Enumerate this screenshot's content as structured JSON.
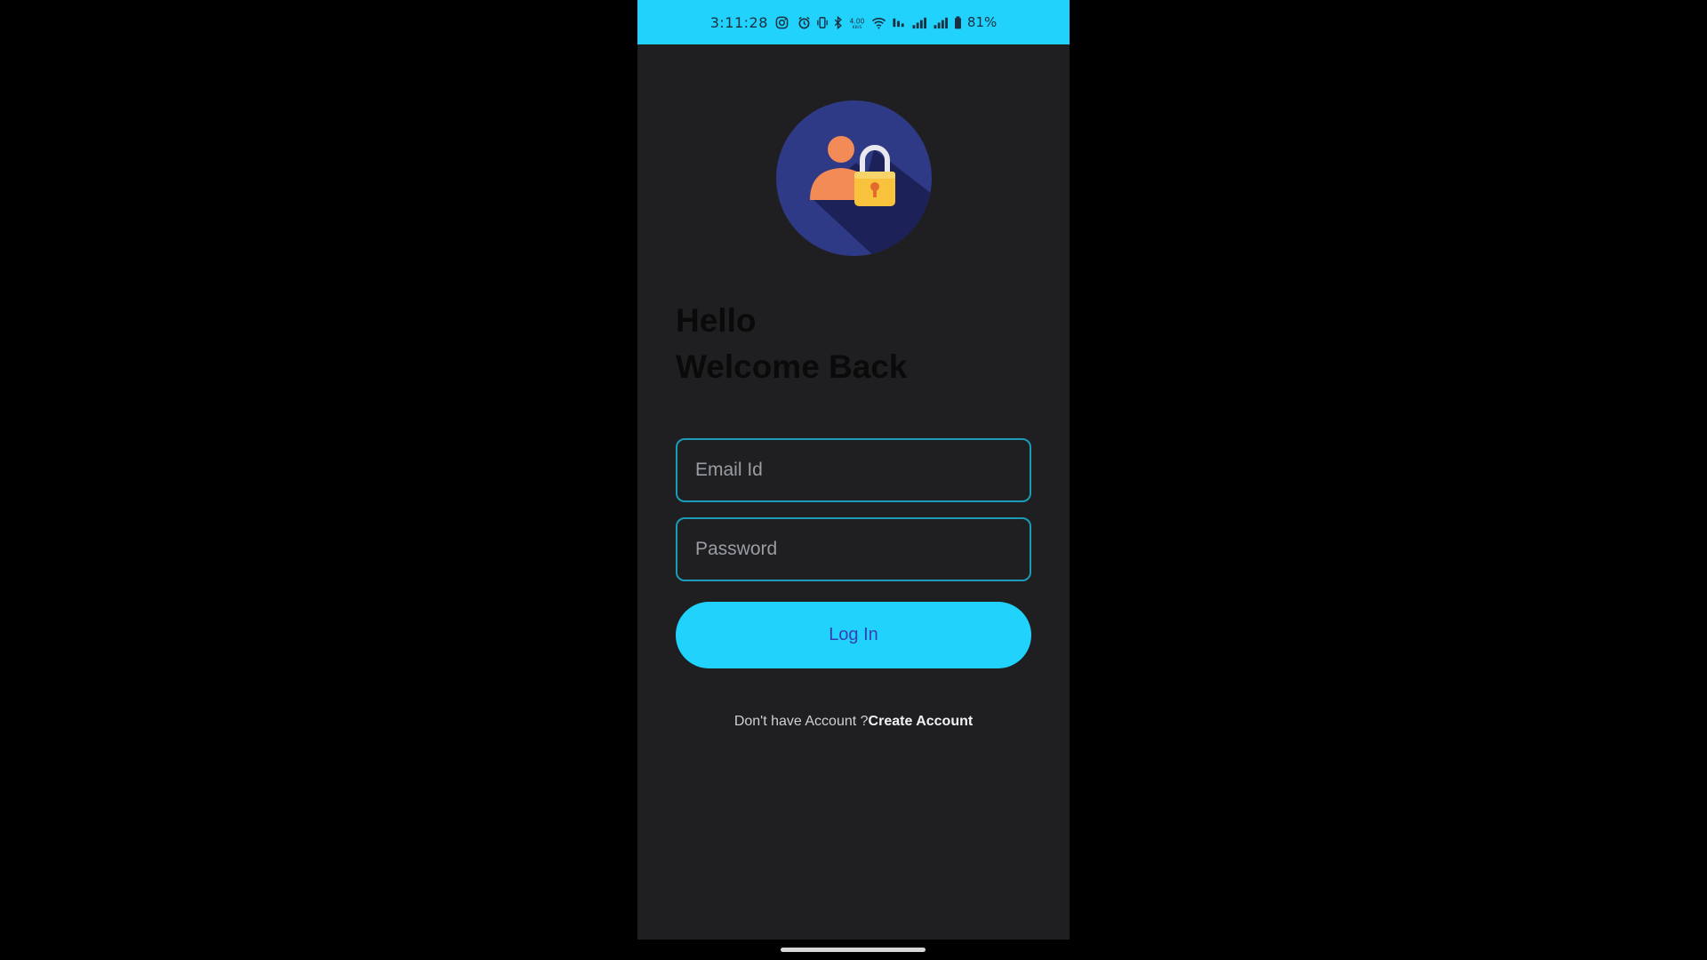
{
  "status_bar": {
    "time": "3:11:28",
    "battery": "81%",
    "background_color": "#20d2fc",
    "icons": [
      "instagram-icon",
      "alarm-icon",
      "vibrate-icon",
      "bluetooth-icon",
      "data-speed-icon",
      "wifi-icon",
      "volte-icon",
      "signal-icon",
      "signal-icon",
      "battery-icon"
    ],
    "data_speed": "4.00"
  },
  "login": {
    "logo_icon": "user-lock-icon",
    "greeting_line1": "Hello",
    "greeting_line2": "Welcome Back",
    "email_placeholder": "Email Id",
    "password_placeholder": "Password",
    "login_label": "Log In",
    "signup_prompt": "Don't have Account ?",
    "create_account_label": "Create Account"
  },
  "colors": {
    "accent": "#20d2fc",
    "screen_background": "#1f1f22",
    "field_border": "#1a9bb8",
    "button_text": "#3a3fb0"
  }
}
